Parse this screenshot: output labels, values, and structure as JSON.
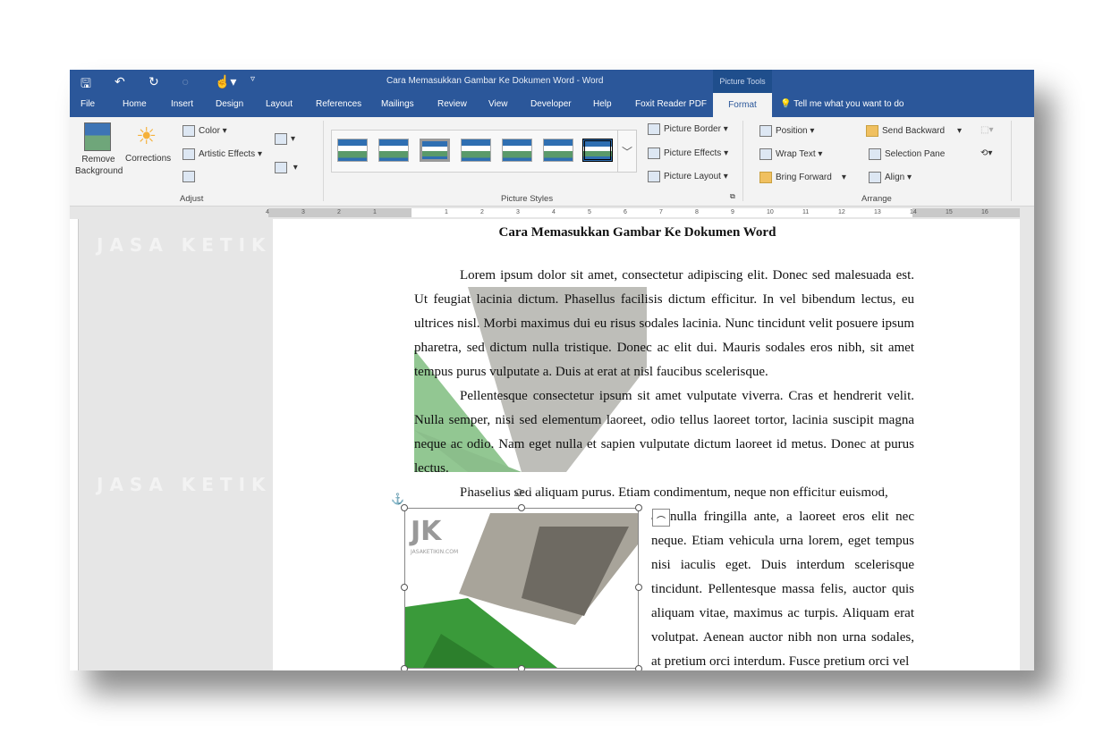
{
  "window": {
    "title": "Cara Memasukkan Gambar Ke Dokumen Word  -  Word",
    "context_tab": "Picture Tools"
  },
  "quick_access": [
    "save-icon",
    "undo-icon",
    "redo-icon",
    "touch-mode-icon",
    "customize-icon"
  ],
  "tabs": [
    "File",
    "Home",
    "Insert",
    "Design",
    "Layout",
    "References",
    "Mailings",
    "Review",
    "View",
    "Developer",
    "Help",
    "Foxit Reader PDF"
  ],
  "active_tab": "Format",
  "tell_me": "Tell me what you want to do",
  "ribbon": {
    "adjust": {
      "remove_bg": "Remove Background",
      "corrections": "Corrections",
      "color": "Color",
      "artistic": "Artistic Effects",
      "label": "Adjust"
    },
    "styles": {
      "label": "Picture Styles",
      "border": "Picture Border",
      "effects": "Picture Effects",
      "layout": "Picture Layout"
    },
    "arrange": {
      "position": "Position",
      "wrap": "Wrap Text",
      "bring": "Bring Forward",
      "send": "Send Backward",
      "selection": "Selection Pane",
      "align": "Align",
      "label": "Arrange"
    }
  },
  "ruler": [
    "4",
    "3",
    "2",
    "1",
    "",
    "1",
    "2",
    "3",
    "4",
    "5",
    "6",
    "7",
    "8",
    "9",
    "10",
    "11",
    "12",
    "13",
    "14",
    "15",
    "16"
  ],
  "document": {
    "heading": "Cara Memasukkan Gambar Ke Dokumen Word",
    "p1": "Lorem ipsum dolor sit amet, consectetur adipiscing elit. Donec sed malesuada est. Ut feugiat lacinia dictum. Phasellus facilisis dictum efficitur. In vel bibendum lectus, eu ultrices nisl. Morbi maximus dui eu risus sodales lacinia. Nunc tincidunt velit posuere ipsum pharetra, sed dictum nulla tristique. Donec ac elit dui. Mauris sodales eros nibh, sit amet tempus purus vulputate a. Duis at erat at nisl faucibus scelerisque.",
    "p2": "Pellentesque consectetur ipsum sit amet vulputate viverra. Cras et hendrerit velit. Nulla semper, nisi sed elementum laoreet, odio tellus laoreet tortor, lacinia suscipit magna neque ac odio. Nam eget nulla et sapien vulputate dictum laoreet id metus. Donec at purus lectus.",
    "p3a": "Phasellus sed aliquam purus. Etiam condimentum, neque non efficitur euismod,",
    "p3b": "ac nulla fringilla ante, a laoreet eros elit nec neque. Etiam vehicula urna lorem, eget tempus nisi iaculis eget. Duis interdum scelerisque tincidunt. Pellentesque massa felis, auctor quis aliquam vitae, maximus ac turpis. Aliquam erat volutpat. Aenean auctor nibh non urna sodales, at pretium orci interdum. Fusce pretium orci vel"
  },
  "watermark": "JASA KETIKIN.COM",
  "colors": {
    "accent": "#2b579a",
    "image_green": "#3a9a3a"
  }
}
